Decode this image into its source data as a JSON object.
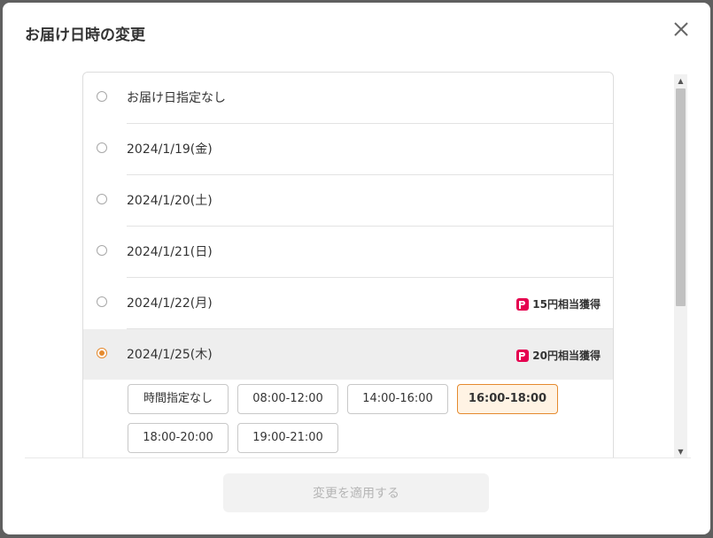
{
  "modal": {
    "title": "お届け日時の変更",
    "apply_button": "変更を適用する"
  },
  "dates": [
    {
      "label": "お届け日指定なし",
      "selected": false,
      "badge": ""
    },
    {
      "label": "2024/1/19(金)",
      "selected": false,
      "badge": ""
    },
    {
      "label": "2024/1/20(土)",
      "selected": false,
      "badge": ""
    },
    {
      "label": "2024/1/21(日)",
      "selected": false,
      "badge": ""
    },
    {
      "label": "2024/1/22(月)",
      "selected": false,
      "badge": "15円相当獲得"
    },
    {
      "label": "2024/1/25(木)",
      "selected": true,
      "badge": "20円相当獲得"
    }
  ],
  "time_slots": [
    {
      "label": "時間指定なし",
      "active": false
    },
    {
      "label": "08:00-12:00",
      "active": false
    },
    {
      "label": "14:00-16:00",
      "active": false
    },
    {
      "label": "16:00-18:00",
      "active": true
    },
    {
      "label": "18:00-20:00",
      "active": false
    },
    {
      "label": "19:00-21:00",
      "active": false
    }
  ],
  "colors": {
    "accent": "#e58a2e",
    "paypay": "#e5004f",
    "selected_bg": "#eeeeee"
  }
}
